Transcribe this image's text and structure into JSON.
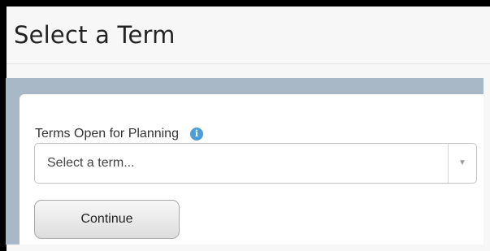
{
  "page": {
    "title": "Select a Term"
  },
  "term_field": {
    "label": "Terms Open for Planning",
    "info_icon": "info-icon",
    "info_glyph": "i",
    "placeholder": "Select a term...",
    "arrow_icon": "chevron-down-icon",
    "arrow_glyph": "▼"
  },
  "actions": {
    "continue_label": "Continue"
  },
  "colors": {
    "panel_blue": "#a9b8c6",
    "info_icon_blue": "#4d9ed6",
    "page_background": "#f7f7f7"
  }
}
